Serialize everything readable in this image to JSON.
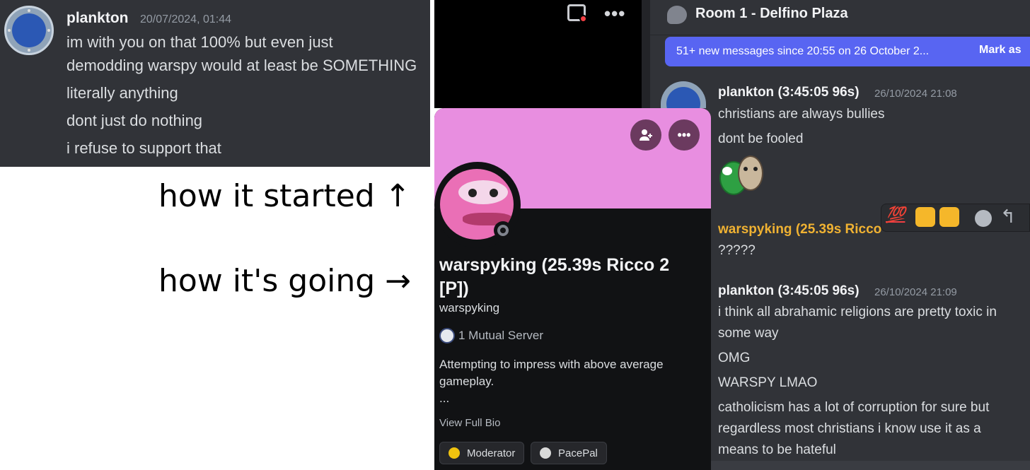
{
  "top_panel": {
    "username": "plankton",
    "timestamp": "20/07/2024, 01:44",
    "messages": [
      "im with you on that 100% but even just",
      "demodding warspy would at least be SOMETHING",
      "literally anything",
      "dont just do nothing",
      "i refuse to support that"
    ]
  },
  "captions": {
    "started": "how it started ↑",
    "going": "how it's going →"
  },
  "profile": {
    "display_name_line1": "warspyking (25.39s Ricco 2",
    "display_name_line2": "[P])",
    "username": "warspyking",
    "mutual": "1 Mutual Server",
    "bio_line1": "Attempting to impress with above average",
    "bio_line2": "gameplay.",
    "bio_more": "...",
    "view_full_bio": "View Full Bio",
    "roles": [
      {
        "label": "Moderator",
        "color": "#f0c30f"
      },
      {
        "label": "PacePal",
        "color": "#d9d9d9"
      }
    ],
    "banner_color": "#e88ee0"
  },
  "chat": {
    "channel_title": "Room 1 - Delfino Plaza",
    "new_messages_bar": "51+ new messages since 20:55 on 26 October 2...",
    "mark_as_read": "Mark as",
    "messages": [
      {
        "author": "plankton (3:45:05 96s)",
        "timestamp": "26/10/2024 21:08",
        "lines": [
          "christians are always bullies",
          "dont be fooled"
        ]
      },
      {
        "author": "warspyking (25.39s Ricco",
        "lines": [
          "?????"
        ]
      },
      {
        "author": "plankton (3:45:05 96s)",
        "timestamp": "26/10/2024 21:09",
        "lines": [
          "i think all abrahamic religions are pretty toxic in",
          "some way",
          "OMG",
          "WARSPY LMAO",
          "catholicism has a lot of corruption for sure but",
          "regardless most christians i know use it as a",
          "means to be hateful"
        ]
      }
    ],
    "reactions": [
      "100-emoji",
      "thumbs-up-emoji",
      "thumbs-down-emoji",
      "add-reaction-icon",
      "reply-icon"
    ]
  }
}
